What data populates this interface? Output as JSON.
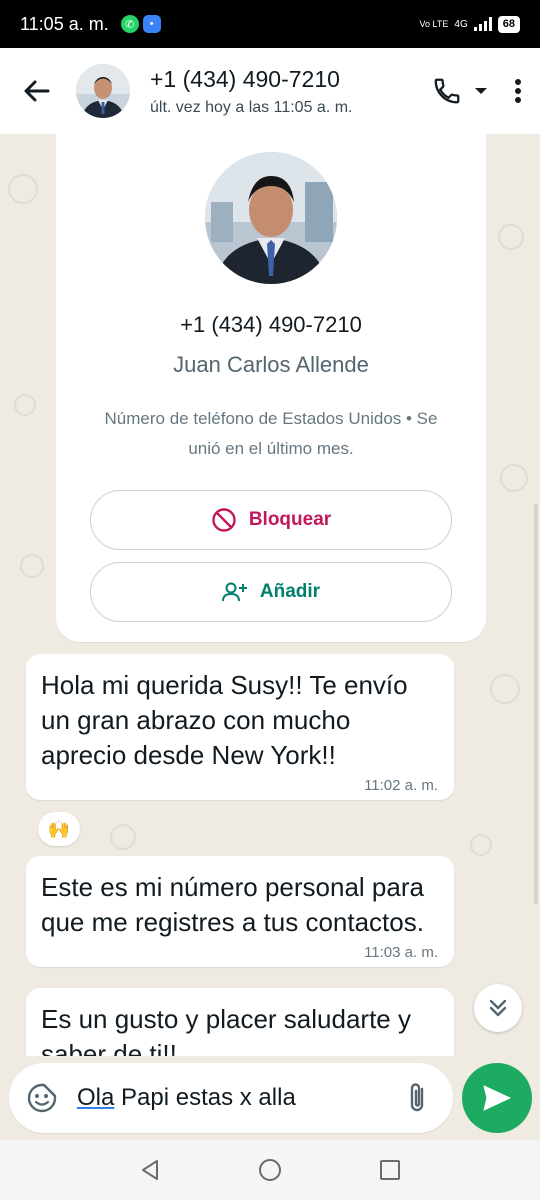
{
  "status_bar": {
    "time": "11:05 a. m.",
    "volte": "Vo LTE",
    "network": "4G",
    "battery": "68"
  },
  "header": {
    "title": "+1 (434) 490-7210",
    "subtitle": "últ. vez hoy a las 11:05 a. m."
  },
  "profile": {
    "phone": "+1 (434) 490-7210",
    "name": "Juan Carlos Allende",
    "description": "Número de teléfono de Estados Unidos • Se unió en el último mes.",
    "block_label": "Bloquear",
    "add_label": "Añadir"
  },
  "messages": [
    {
      "text": "Hola mi querida Susy!! Te envío un gran abrazo con mucho aprecio desde New York!!",
      "time": "11:02 a. m."
    },
    {
      "text": "Este es mi número personal para que me registres a tus contactos.",
      "time": "11:03 a. m."
    },
    {
      "text": "Es un gusto y placer saludarte y saber de ti!!",
      "time": ""
    }
  ],
  "reaction": "🙌",
  "composer": {
    "text_underlined": "Ola",
    "text_rest": " Papi estas x alla"
  },
  "colors": {
    "accent_green": "#1daa61",
    "block_red": "#c2185b",
    "add_green": "#00806a",
    "chat_bg": "#efeae2"
  }
}
